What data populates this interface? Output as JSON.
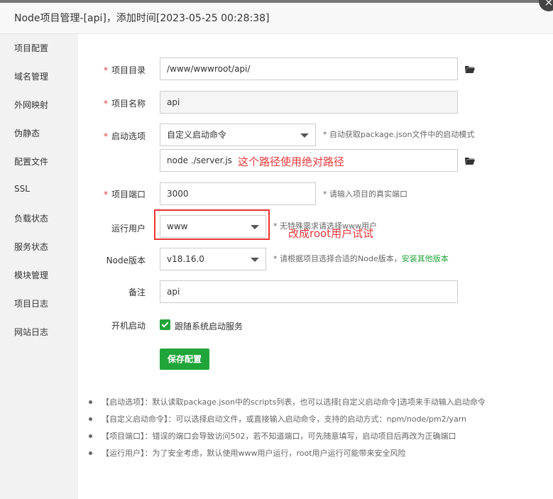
{
  "title": "Node项目管理-[api]，添加时间[2023-05-25 00:28:38]",
  "close_glyph": "×",
  "sidebar": [
    "项目配置",
    "域名管理",
    "外网映射",
    "伪静态",
    "配置文件",
    "SSL",
    "负载状态",
    "服务状态",
    "模块管理",
    "项目日志",
    "网站日志"
  ],
  "form": {
    "required_mark": "*",
    "dir_label": "项目目录",
    "dir_value": "/www/wwwroot/api/",
    "name_label": "项目名称",
    "name_value": "api",
    "start_label": "启动选项",
    "start_value": "自定义启动命令",
    "start_hint": "* 自动获取package.json文件中的启动模式",
    "cmd_value": "node ./server.js",
    "cmd_annotation": "这个路径使用绝对路径",
    "port_label": "项目端口",
    "port_value": "3000",
    "port_hint": "* 请输入项目的真实端口",
    "user_label": "运行用户",
    "user_value": "www",
    "user_hint": "* 无特殊需求请选择www用户",
    "user_annotation": "改成root用户试试",
    "node_label": "Node版本",
    "node_value": "v18.16.0",
    "node_hint": "* 请根据项目选择合适的Node版本，",
    "node_link": "安装其他版本",
    "remark_label": "备注",
    "remark_value": "api",
    "boot_label": "开机启动",
    "boot_check_label": "跟随系统启动服务",
    "save_label": "保存配置"
  },
  "notes": [
    "【启动选项】：默认读取package.json中的scripts列表，也可以选择[自定义启动命令]选项来手动输入启动命令",
    "【自定义启动命令】：可以选择启动文件，或直接输入启动命令，支持的启动方式：npm/node/pm2/yarn",
    "【项目端口】：错误的端口会导致访问502，若不知道端口，可先随意填写，启动项目后再改为正确端口",
    "【运行用户】：为了安全考虑，默认使用www用户运行，root用户运行可能带来安全风险"
  ],
  "colors": {
    "accent": "#20a53a",
    "annotation": "#e5383b"
  },
  "icons": {
    "folder": "folder-icon",
    "dropdown": "chevron-down-icon",
    "check": "check-icon",
    "close": "close-icon"
  }
}
